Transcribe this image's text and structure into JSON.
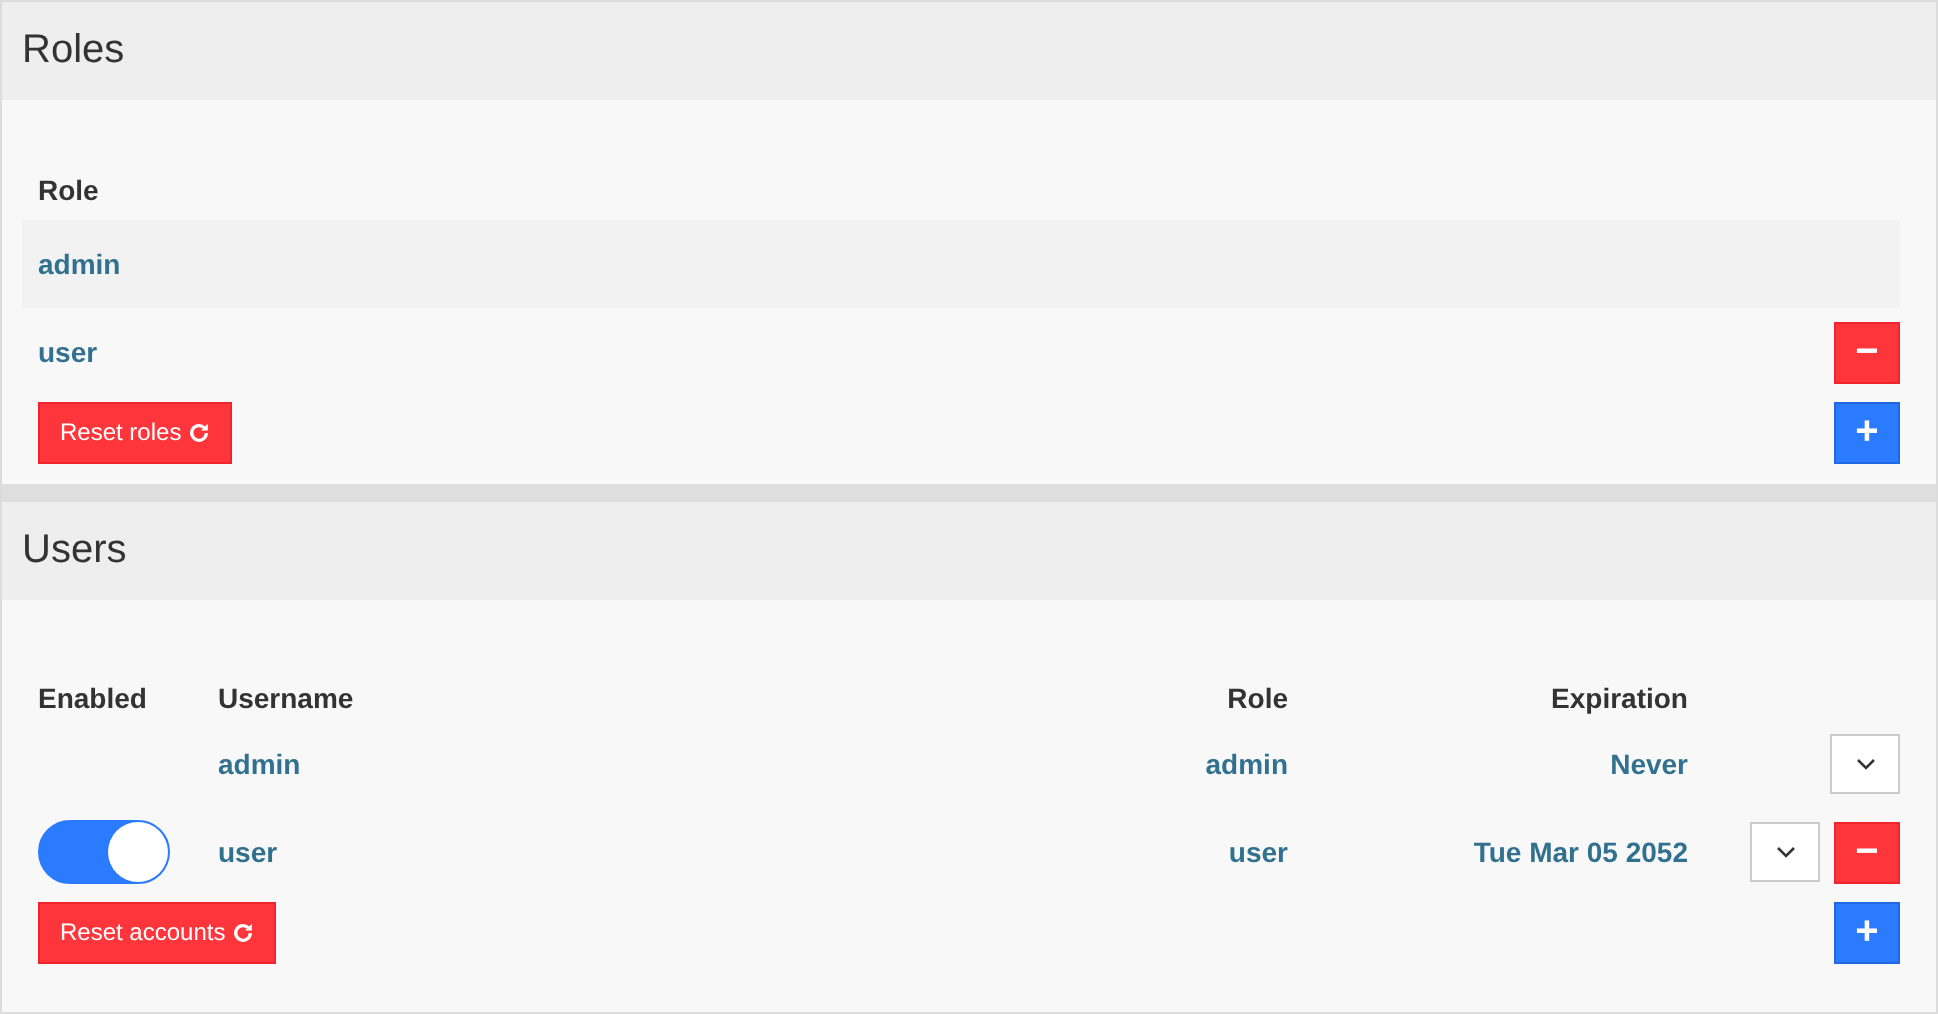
{
  "roles": {
    "title": "Roles",
    "column": "Role",
    "rows": [
      {
        "name": "admin",
        "removable": false
      },
      {
        "name": "user",
        "removable": true
      }
    ],
    "remove_label": "−",
    "add_label": "+",
    "reset_label": "Reset roles"
  },
  "users": {
    "title": "Users",
    "columns": [
      "Enabled",
      "Username",
      "Role",
      "Expiration"
    ],
    "rows": [
      {
        "username": "admin",
        "role": "admin",
        "expiration": "Never",
        "removable": false
      },
      {
        "enabled": true,
        "username": "user",
        "role": "user",
        "expiration": "Tue Mar 05 2052",
        "removable": true
      }
    ],
    "remove_label": "−",
    "add_label": "+",
    "reset_label": "Reset accounts"
  }
}
